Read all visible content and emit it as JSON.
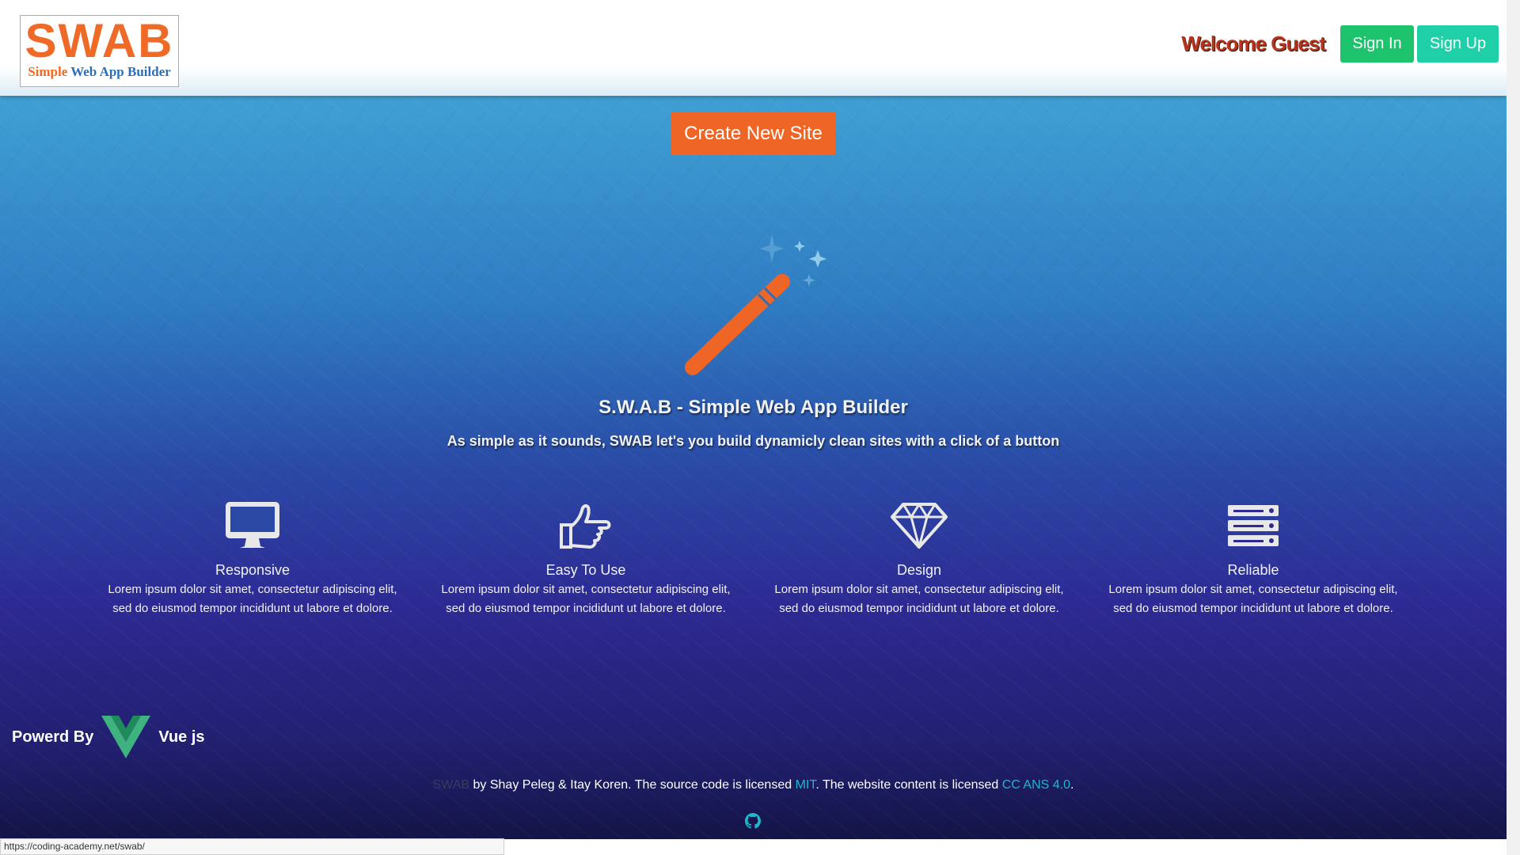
{
  "header": {
    "logo_big": "SWAB",
    "logo_small_1": "Simple",
    "logo_small_2": "Web App Builder",
    "welcome": "Welcome Guest",
    "signin_label": "Sign In",
    "signup_label": "Sign Up"
  },
  "hero": {
    "create_label": "Create New Site",
    "title": "S.W.A.B - Simple Web App Builder",
    "subtitle": "As simple as it sounds, SWAB let's you build dynamicly clean sites with a click of a button"
  },
  "features": [
    {
      "icon": "monitor-icon",
      "title": "Responsive",
      "desc1": "Lorem ipsum dolor sit amet, consectetur adipiscing elit,",
      "desc2": "sed do eiusmod tempor incididunt ut labore et dolore."
    },
    {
      "icon": "thumb-pointing-icon",
      "title": "Easy To Use",
      "desc1": "Lorem ipsum dolor sit amet, consectetur adipiscing elit,",
      "desc2": "sed do eiusmod tempor incididunt ut labore et dolore."
    },
    {
      "icon": "diamond-icon",
      "title": "Design",
      "desc1": "Lorem ipsum dolor sit amet, consectetur adipiscing elit,",
      "desc2": "sed do eiusmod tempor incididunt ut labore et dolore."
    },
    {
      "icon": "server-icon",
      "title": "Reliable",
      "desc1": "Lorem ipsum dolor sit amet, consectetur adipiscing elit,",
      "desc2": "sed do eiusmod tempor incididunt ut labore et dolore."
    }
  ],
  "powered": {
    "prefix": "Powerd By",
    "suffix": "Vue js"
  },
  "footer": {
    "brand": "SWAB",
    "text1": " by Shay Peleg & Itay Koren. The source code is licensed ",
    "link1": "MIT",
    "text2": ". The website content is licensed ",
    "link2": "CC ANS 4.0",
    "text3": "."
  },
  "status": {
    "url": "https://coding-academy.net/swab/"
  },
  "colors": {
    "accent_orange": "#ef6526",
    "signin_green": "#1ec36d",
    "signup_teal": "#1ecfa8",
    "link_teal": "#1fb8c9",
    "welcome_red": "#b9321c"
  }
}
